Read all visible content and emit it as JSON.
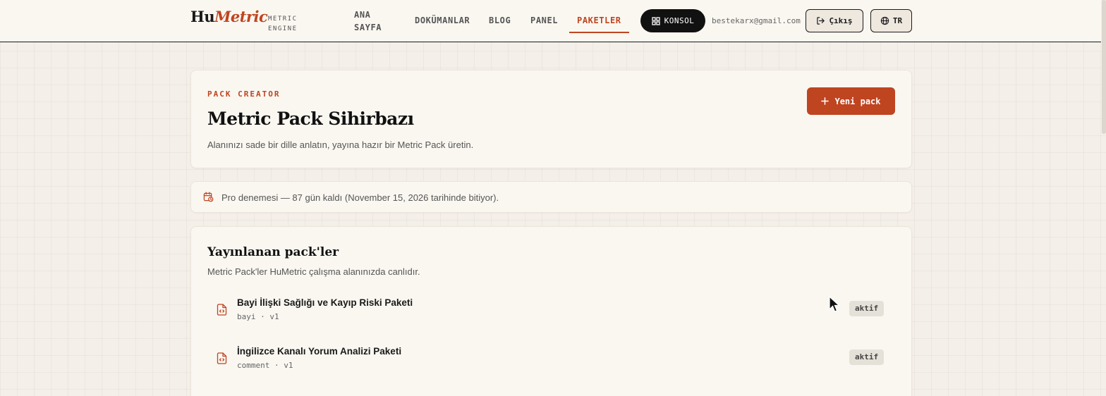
{
  "brand": {
    "logo_part1": "Hu",
    "logo_part2": "Metric",
    "subtitle": "METRIC ENGINE"
  },
  "nav": {
    "home": "ANA SAYFA",
    "docs": "DOKÜMANLAR",
    "blog": "BLOG",
    "panel": "PANEL",
    "packs": "PAKETLER",
    "active": "packs"
  },
  "header": {
    "console_label": "KONSOL",
    "user_email": "bestekarx@gmail.com",
    "logout_label": "Çıkış",
    "language_label": "TR"
  },
  "hero": {
    "eyebrow": "PACK CREATOR",
    "title": "Metric Pack Sihirbazı",
    "description": "Alanınızı sade bir dille anlatın, yayına hazır bir Metric Pack üretin.",
    "new_pack_label": "Yeni pack"
  },
  "trial": {
    "text": "Pro denemesi — 87 gün kaldı (November 15, 2026 tarihinde bitiyor)."
  },
  "published": {
    "title": "Yayınlanan pack'ler",
    "description": "Metric Pack'ler HuMetric çalışma alanınızda canlıdır.",
    "items": [
      {
        "name": "Bayi İlişki Sağlığı ve Kayıp Riski Paketi",
        "slug": "bayi",
        "version": "v1",
        "status": "aktif"
      },
      {
        "name": "İngilizce Kanalı Yorum Analizi Paketi",
        "slug": "comment",
        "version": "v1",
        "status": "aktif"
      }
    ]
  },
  "colors": {
    "accent": "#bf4420",
    "background": "#f4efe9",
    "card": "#faf7f1",
    "dark": "#111111"
  },
  "icons": {
    "console": "grid-icon",
    "logout": "logout-icon",
    "language": "globe-icon",
    "new_pack": "plus-icon",
    "trial": "calendar-clock-icon",
    "pack": "file-code-icon"
  }
}
